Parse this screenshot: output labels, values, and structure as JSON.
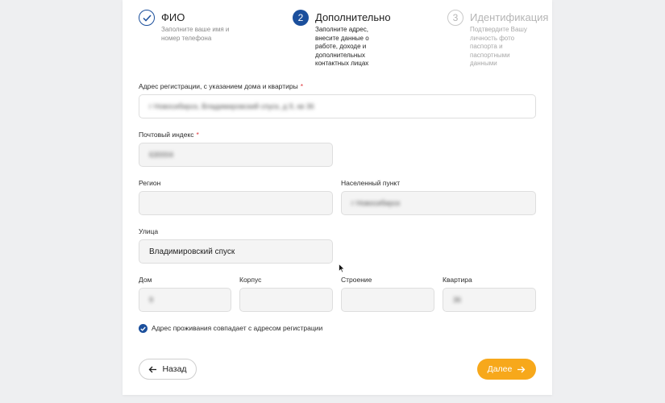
{
  "stepper": {
    "steps": [
      {
        "number": "",
        "title": "ФИО",
        "desc": [
          "Заполните ваше имя и",
          "номер телефона"
        ],
        "state": "done"
      },
      {
        "number": "2",
        "title": "Дополнительно",
        "desc": [
          "Заполните адрес,",
          "внесите данные о",
          "работе, доходе и",
          "дополнительных",
          "контактных лицах"
        ],
        "state": "active"
      },
      {
        "number": "3",
        "title": "Идентификация",
        "desc": [
          "Подтвердите Вашу",
          "личность фото",
          "паспорта и",
          "паспортными",
          "данными"
        ],
        "state": "todo"
      }
    ]
  },
  "form": {
    "address_label": "Адрес регистрации, с указанием дома и квартиры",
    "address_value": "г Новосибирск, Владимировский спуск, д 9, кв 36",
    "postal_label": "Почтовый индекс",
    "postal_value": "630004",
    "region_label": "Регион",
    "region_value": "",
    "city_label": "Населенный пункт",
    "city_value": "г Новосибирск",
    "street_label": "Улица",
    "street_value": "Владимировский спуск",
    "house_label": "Дом",
    "house_value": "9",
    "korpus_label": "Корпус",
    "korpus_value": "",
    "stroenie_label": "Строение",
    "stroenie_value": "",
    "kvartira_label": "Квартира",
    "kvartira_value": "36",
    "required_mark": "*",
    "same_address_label": "Адрес проживания совпадает с адресом регистрации",
    "same_address_checked": true
  },
  "buttons": {
    "back_label": "Назад",
    "next_label": "Далее"
  },
  "colors": {
    "accent_blue": "#1b4f9c",
    "next_button": "#f7a81b",
    "required": "#e0343a"
  }
}
